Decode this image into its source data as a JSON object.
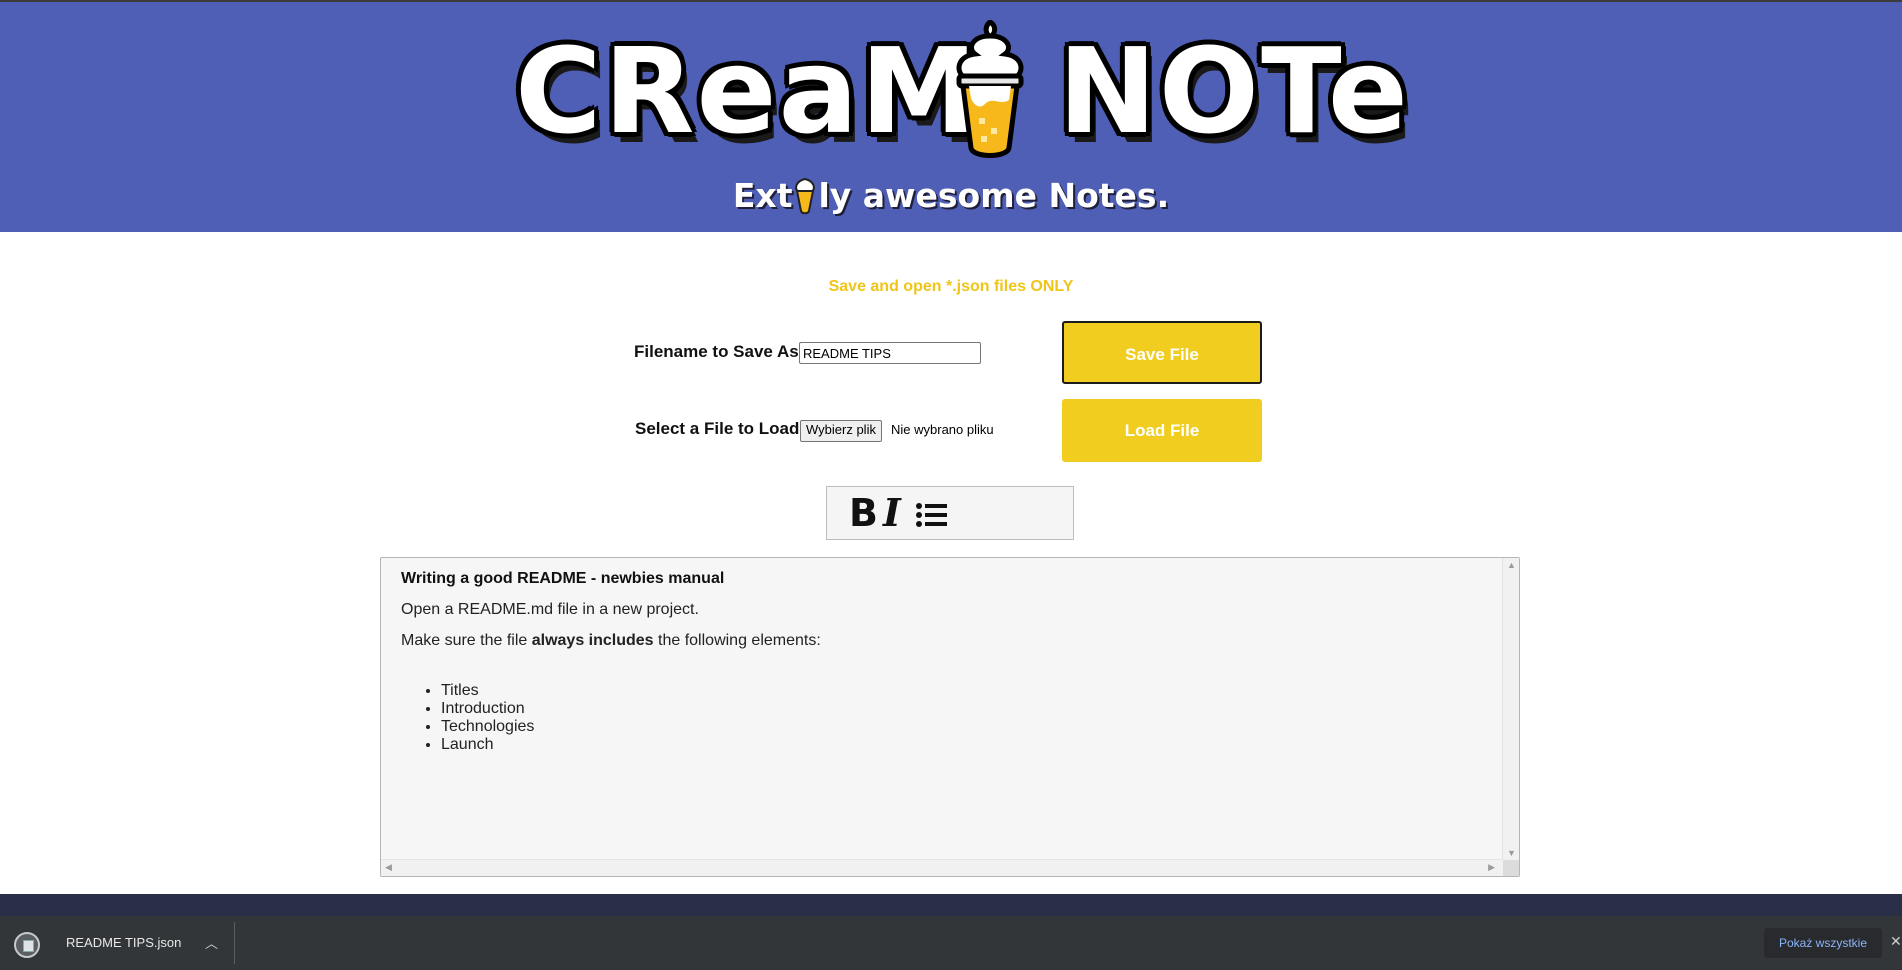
{
  "header": {
    "logo_left": "CReaM",
    "logo_right": "NOTe",
    "tagline_before": "Ext",
    "tagline_after": "ly awesome Notes."
  },
  "form": {
    "notice": "Save and open *.json files ONLY",
    "save_label": "Filename to Save As:",
    "filename_value": "README TIPS",
    "save_button": "Save File",
    "load_label": "Select a File to Load:",
    "choose_button": "Wybierz plik",
    "file_status": "Nie wybrano pliku",
    "load_button": "Load File"
  },
  "toolbar": {
    "bold": "B",
    "italic": "I",
    "list_icon": "list-icon"
  },
  "editor": {
    "heading": "Writing a good README - newbies manual",
    "paragraph1": "Open a README.md file in a new project.",
    "p2_before": "Make sure the file ",
    "p2_bold": "always includes",
    "p2_after": " the following elements:",
    "items": [
      "Titles",
      "Introduction",
      "Technologies",
      "Launch"
    ]
  },
  "downloads": {
    "file_name": "README TIPS.json",
    "show_all": "Pokaż wszystkie"
  },
  "colors": {
    "header_bg": "#4f5fb5",
    "accent_yellow": "#f1cd1f",
    "notice_yellow": "#f0c419",
    "footer": "#2a2e47",
    "download_bar": "#323639"
  }
}
